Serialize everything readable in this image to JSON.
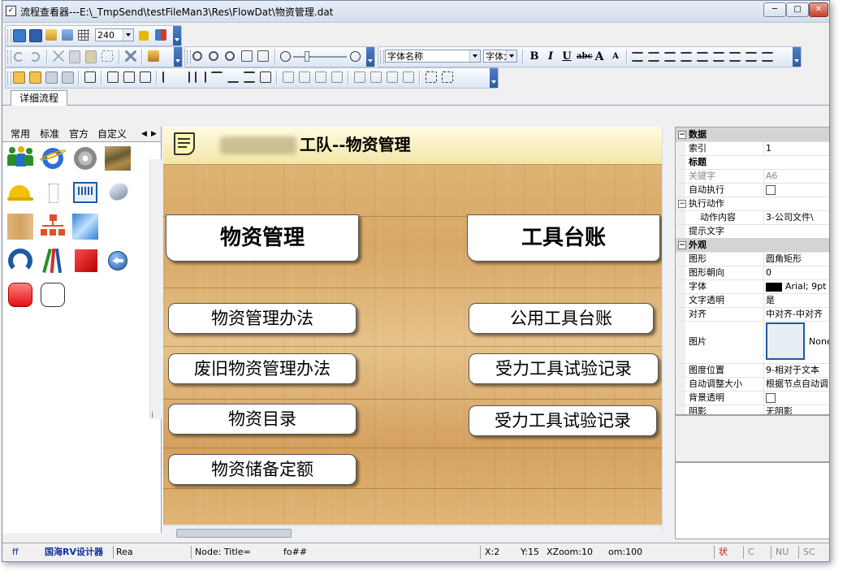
{
  "window": {
    "title": "流程查看器---E:\\_TmpSend\\testFileMan3\\Res\\FlowDat\\物资管理.dat",
    "minimize": "─",
    "maximize": "□",
    "close": "✕"
  },
  "toolbar1": {
    "zoom_value": "240"
  },
  "toolbar2": {
    "font_name": "字体名称",
    "font_size": "字体大"
  },
  "toolbar_text_buttons": {
    "bold": "B",
    "italic": "I",
    "underline": "U",
    "strike": "abc",
    "grow": "A",
    "shrink": "A"
  },
  "tabs": {
    "detail_flow": "详细流程"
  },
  "left_panel": {
    "tabs": [
      "常用",
      "标准",
      "官方",
      "自定义"
    ],
    "scroll_left": "◀",
    "scroll_right": "▶"
  },
  "canvas": {
    "banner_title": "工队--物资管理",
    "cards": [
      {
        "label": "物资管理"
      },
      {
        "label": "工具台账"
      }
    ],
    "pills": [
      {
        "label": "物资管理办法"
      },
      {
        "label": "废旧物资管理办法"
      },
      {
        "label": "物资目录"
      },
      {
        "label": "物资储备定额"
      },
      {
        "label": "公用工具台账"
      },
      {
        "label": "受力工具试验记录"
      },
      {
        "label": "受力工具试验记录"
      }
    ]
  },
  "properties": {
    "section_data": "数据",
    "index_key": "索引",
    "index_val": "1",
    "title_key": "标题",
    "title_val": "",
    "keyword_key": "关键字",
    "keyword_val": "A6",
    "auto_exec_key": "自动执行",
    "action_key": "执行动作",
    "action_content_key": "动作内容",
    "action_content_val": "3-公司文件\\",
    "hint_key": "提示文字",
    "hint_val": "",
    "section_appearance": "外观",
    "shape_key": "图形",
    "shape_val": "圆角矩形",
    "orient_key": "图形朝向",
    "orient_val": "0",
    "font_key": "字体",
    "font_val": "Arial; 9pt",
    "text_transparent_key": "文字透明",
    "text_transparent_val": "是",
    "align_key": "对齐",
    "align_val": "中对齐-中对齐",
    "image_key": "图片",
    "image_val": "None",
    "image_pos_key": "图度位置",
    "image_pos_val": "9-相对于文本",
    "auto_size_key": "自动调整大小",
    "auto_size_val": "根据节点自动调",
    "bg_transparent_key": "背景透明",
    "shadow_key": "阴影",
    "shadow_val": "无阴影"
  },
  "status": {
    "s1": "ff",
    "s2": "国海RV设计器",
    "s3": "Rea",
    "s4": "Node: Title=",
    "s5": "fo##",
    "s6": "X:2",
    "s7": "Y:15",
    "s8": "XZoom:10",
    "s9": "om:100",
    "s10": "状",
    "s11": "C",
    "s12": "NU",
    "s13": "SC"
  },
  "colors": {
    "canvas_wood": "#dcae6e",
    "banner_bg": "#fdf5c8",
    "toolbar_end": "#2c5aa0",
    "status_red": "#d01010",
    "status_blue": "#1030a0"
  }
}
